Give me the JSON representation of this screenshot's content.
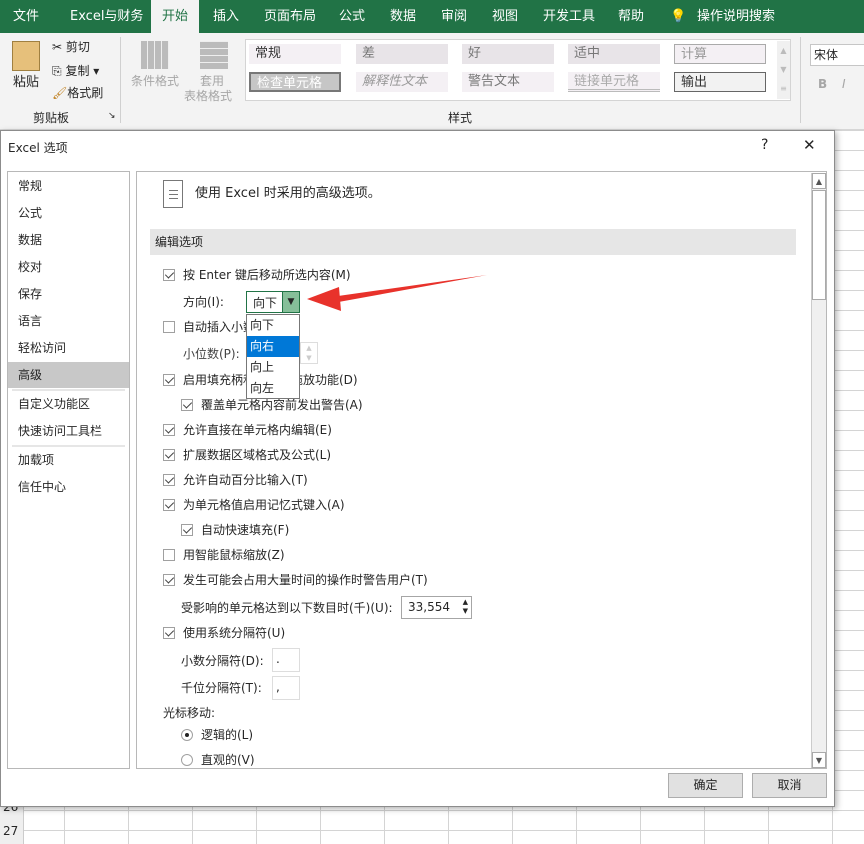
{
  "ribbon_tabs": [
    "文件",
    "Excel与财务",
    "开始",
    "插入",
    "页面布局",
    "公式",
    "数据",
    "审阅",
    "视图",
    "开发工具",
    "帮助",
    "操作说明搜索"
  ],
  "clipboard": {
    "paste": "粘贴",
    "cut": "剪切",
    "copy": "复制",
    "format_painter": "格式刷",
    "group": "剪贴板"
  },
  "styles_group": {
    "conditional": "条件格式",
    "table_format_1": "套用",
    "table_format_2": "表格格式",
    "group": "样式",
    "cells": [
      "常规",
      "差",
      "好",
      "适中",
      "计算",
      "检查单元格",
      "解释性文本",
      "警告文本",
      "链接单元格",
      "输出"
    ]
  },
  "font": {
    "name": "宋体",
    "bold": "B",
    "italic": "I"
  },
  "rows": [
    "26",
    "27"
  ],
  "dialog": {
    "title": "Excel 选项",
    "help": "?",
    "close": "✕",
    "nav": [
      "常规",
      "公式",
      "数据",
      "校对",
      "保存",
      "语言",
      "轻松访问",
      "高级",
      "自定义功能区",
      "快速访问工具栏",
      "加载项",
      "信任中心"
    ],
    "header": "使用 Excel 时采用的高级选项。",
    "section": "编辑选项",
    "enter_move": "按 Enter 键后移动所选内容(M)",
    "direction_label": "方向(I):",
    "direction_value": "向下",
    "direction_options": [
      "向下",
      "向右",
      "向上",
      "向左"
    ],
    "auto_decimal": "自动插入小数点(D)",
    "decimal_places": "小位数(P):",
    "fill_handle": "启用填充柄和单元格拖放功能(D)",
    "overwrite_alert": "覆盖单元格内容前发出警告(A)",
    "edit_in_cell": "允许直接在单元格内编辑(E)",
    "extend_formats": "扩展数据区域格式及公式(L)",
    "auto_percent": "允许自动百分比输入(T)",
    "autocomplete": "为单元格值启用记忆式键入(A)",
    "flash_fill": "自动快速填充(F)",
    "intellimouse": "用智能鼠标缩放(Z)",
    "alert_slow": "发生可能会占用大量时间的操作时警告用户(T)",
    "cells_affected": "受影响的单元格达到以下数目时(千)(U):",
    "cells_value": "33,554",
    "system_sep": "使用系统分隔符(U)",
    "decimal_sep": "小数分隔符(D):",
    "decimal_sep_value": ".",
    "thousands_sep": "千位分隔符(T):",
    "thousands_sep_value": ",",
    "cursor_move": "光标移动:",
    "logical": "逻辑的(L)",
    "visual": "直观的(V)",
    "ok": "确定",
    "cancel": "取消"
  }
}
